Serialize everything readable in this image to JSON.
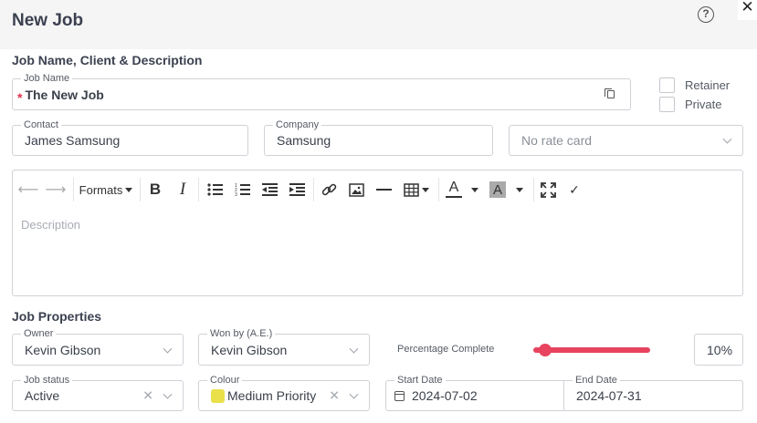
{
  "header": {
    "title": "New Job",
    "help_glyph": "?",
    "close_glyph": "✕"
  },
  "sections": {
    "details": "Job Name, Client & Description",
    "properties": "Job Properties"
  },
  "job_name": {
    "label": "Job Name",
    "value": "The New Job",
    "required_mark": "*"
  },
  "flags": {
    "retainer_label": "Retainer",
    "private_label": "Private"
  },
  "contact": {
    "label": "Contact",
    "value": "James Samsung"
  },
  "company": {
    "label": "Company",
    "value": "Samsung"
  },
  "rate_card": {
    "placeholder": "No rate card"
  },
  "editor": {
    "formats_label": "Formats",
    "placeholder": "Description",
    "bold_glyph": "B",
    "italic_glyph": "I",
    "font_color_glyph": "A",
    "bg_color_glyph": "A",
    "undo_glyph": "⟵",
    "redo_glyph": "⟶",
    "check_glyph": "✓",
    "fullscreen_glyph": "⛶"
  },
  "owner": {
    "label": "Owner",
    "value": "Kevin Gibson"
  },
  "won_by": {
    "label": "Won by (A.E.)",
    "value": "Kevin Gibson"
  },
  "percentage": {
    "label": "Percentage Complete",
    "value": "10%",
    "fraction": 0.1
  },
  "job_status": {
    "label": "Job status",
    "value": "Active"
  },
  "colour": {
    "label": "Colour",
    "value": "Medium Priority",
    "swatch_color": "#e9e04a"
  },
  "start_date": {
    "label": "Start Date",
    "value": "2024-07-02"
  },
  "end_date": {
    "label": "End Date",
    "value": "2024-07-31"
  },
  "colors": {
    "accent": "#e8445f",
    "border": "#cfd2d7",
    "required": "#e0314b"
  }
}
